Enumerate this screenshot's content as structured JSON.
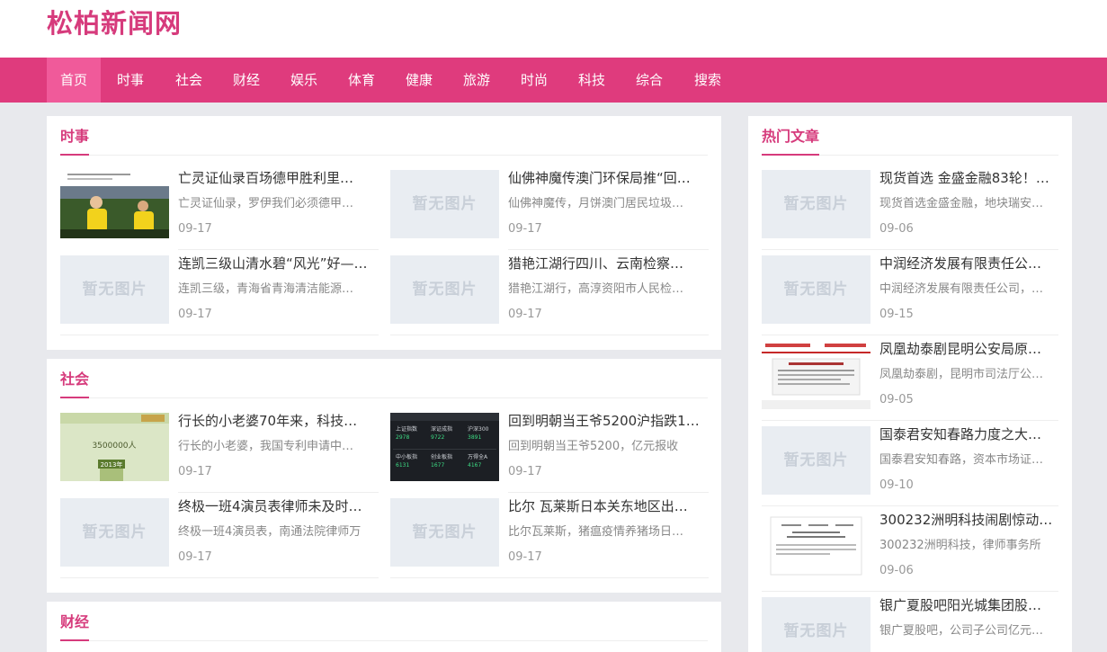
{
  "site": {
    "title": "松柏新闻网"
  },
  "nav": [
    "首页",
    "时事",
    "社会",
    "财经",
    "娱乐",
    "体育",
    "健康",
    "旅游",
    "时尚",
    "科技",
    "综合",
    "搜索"
  ],
  "placeholder_text": "暂无图片",
  "colors": {
    "brand": "#d63b7c",
    "nav_bg": "#df3b7d",
    "nav_active": "#f05a9a",
    "page_bg": "#e8e9ed"
  },
  "sections": [
    {
      "title": "时事",
      "items": [
        {
          "title": "亡灵证仙录百场德甲胜利里…",
          "desc": "亡灵证仙录，罗伊我们必须德甲…",
          "date": "09-17",
          "image": "photo"
        },
        {
          "title": "仙佛神魔传澳门环保局推“回…",
          "desc": "仙佛神魔传，月饼澳门居民垃圾…",
          "date": "09-17",
          "image": "none"
        },
        {
          "title": "连凯三级山清水碧“风光”好—…",
          "desc": "连凯三级，青海省青海清洁能源…",
          "date": "09-17",
          "image": "none"
        },
        {
          "title": "猎艳江湖行四川、云南检察…",
          "desc": "猎艳江湖行，高淳资阳市人民检…",
          "date": "09-17",
          "image": "none"
        }
      ]
    },
    {
      "title": "社会",
      "items": [
        {
          "title": "行长的小老婆70年来，科技…",
          "desc": "行长的小老婆，我国专利申请中…",
          "date": "09-17",
          "image": "photo"
        },
        {
          "title": "回到明朝当王爷5200沪指跌1…",
          "desc": "回到明朝当王爷5200，亿元报收",
          "date": "09-17",
          "image": "photo"
        },
        {
          "title": "终极一班4演员表律师未及时…",
          "desc": "终极一班4演员表，南通法院律师万",
          "date": "09-17",
          "image": "none"
        },
        {
          "title": "比尔 瓦莱斯日本关东地区出…",
          "desc": "比尔瓦莱斯，猪瘟疫情养猪场日…",
          "date": "09-17",
          "image": "none"
        }
      ]
    },
    {
      "title": "财经",
      "items": []
    }
  ],
  "hot": {
    "title": "热门文章",
    "items": [
      {
        "title": "现货首选 金盛金融83轮！…",
        "desc": "现货首选金盛金融，地块瑞安…",
        "date": "09-06",
        "image": "none"
      },
      {
        "title": "中润经济发展有限责任公…",
        "desc": "中润经济发展有限责任公司，…",
        "date": "09-15",
        "image": "none"
      },
      {
        "title": "凤凰劫泰剧昆明公安局原…",
        "desc": "凤凰劫泰剧，昆明市司法厅公…",
        "date": "09-05",
        "image": "document"
      },
      {
        "title": "国泰君安知春路力度之大…",
        "desc": "国泰君安知春路，资本市场证…",
        "date": "09-10",
        "image": "none"
      },
      {
        "title": "300232洲明科技闹剧惊动…",
        "desc": "300232洲明科技，律师事务所",
        "date": "09-06",
        "image": "document"
      },
      {
        "title": "银广夏股吧阳光城集团股…",
        "desc": "银广夏股吧，公司子公司亿元…",
        "date": "",
        "image": "none"
      }
    ]
  }
}
